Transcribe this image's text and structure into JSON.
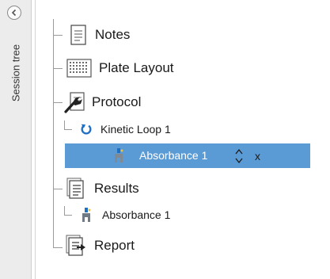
{
  "side_panel": {
    "label": "Session tree"
  },
  "tree": {
    "notes": {
      "label": "Notes",
      "icon": "notes-icon"
    },
    "plate_layout": {
      "label": "Plate Layout",
      "icon": "plate-grid-icon"
    },
    "protocol": {
      "label": "Protocol",
      "icon": "wrench-icon",
      "children": {
        "kinetic_loop": {
          "label": "Kinetic Loop 1",
          "icon": "loop-icon",
          "children": {
            "absorbance": {
              "label": "Absorbance 1",
              "icon": "absorbance-icon",
              "selected": true,
              "remove_label": "x"
            }
          }
        }
      }
    },
    "results": {
      "label": "Results",
      "icon": "results-icon",
      "children": {
        "absorbance": {
          "label": "Absorbance 1",
          "icon": "absorbance-icon"
        }
      }
    },
    "report": {
      "label": "Report",
      "icon": "report-icon"
    }
  },
  "colors": {
    "selection": "#5b9bd5",
    "loop_icon": "#1f6fc5",
    "tree_lines": "#9a9a9a"
  }
}
